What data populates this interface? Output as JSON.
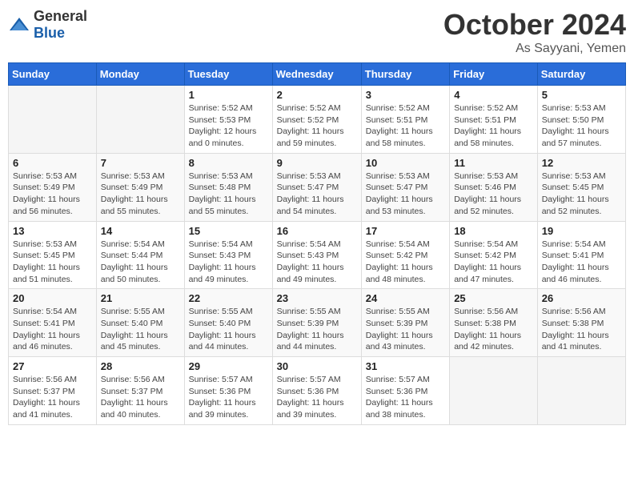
{
  "logo": {
    "general": "General",
    "blue": "Blue"
  },
  "header": {
    "month": "October 2024",
    "location": "As Sayyani, Yemen"
  },
  "weekdays": [
    "Sunday",
    "Monday",
    "Tuesday",
    "Wednesday",
    "Thursday",
    "Friday",
    "Saturday"
  ],
  "weeks": [
    [
      {
        "day": "",
        "info": ""
      },
      {
        "day": "",
        "info": ""
      },
      {
        "day": "1",
        "info": "Sunrise: 5:52 AM\nSunset: 5:53 PM\nDaylight: 12 hours\nand 0 minutes."
      },
      {
        "day": "2",
        "info": "Sunrise: 5:52 AM\nSunset: 5:52 PM\nDaylight: 11 hours\nand 59 minutes."
      },
      {
        "day": "3",
        "info": "Sunrise: 5:52 AM\nSunset: 5:51 PM\nDaylight: 11 hours\nand 58 minutes."
      },
      {
        "day": "4",
        "info": "Sunrise: 5:52 AM\nSunset: 5:51 PM\nDaylight: 11 hours\nand 58 minutes."
      },
      {
        "day": "5",
        "info": "Sunrise: 5:53 AM\nSunset: 5:50 PM\nDaylight: 11 hours\nand 57 minutes."
      }
    ],
    [
      {
        "day": "6",
        "info": "Sunrise: 5:53 AM\nSunset: 5:49 PM\nDaylight: 11 hours\nand 56 minutes."
      },
      {
        "day": "7",
        "info": "Sunrise: 5:53 AM\nSunset: 5:49 PM\nDaylight: 11 hours\nand 55 minutes."
      },
      {
        "day": "8",
        "info": "Sunrise: 5:53 AM\nSunset: 5:48 PM\nDaylight: 11 hours\nand 55 minutes."
      },
      {
        "day": "9",
        "info": "Sunrise: 5:53 AM\nSunset: 5:47 PM\nDaylight: 11 hours\nand 54 minutes."
      },
      {
        "day": "10",
        "info": "Sunrise: 5:53 AM\nSunset: 5:47 PM\nDaylight: 11 hours\nand 53 minutes."
      },
      {
        "day": "11",
        "info": "Sunrise: 5:53 AM\nSunset: 5:46 PM\nDaylight: 11 hours\nand 52 minutes."
      },
      {
        "day": "12",
        "info": "Sunrise: 5:53 AM\nSunset: 5:45 PM\nDaylight: 11 hours\nand 52 minutes."
      }
    ],
    [
      {
        "day": "13",
        "info": "Sunrise: 5:53 AM\nSunset: 5:45 PM\nDaylight: 11 hours\nand 51 minutes."
      },
      {
        "day": "14",
        "info": "Sunrise: 5:54 AM\nSunset: 5:44 PM\nDaylight: 11 hours\nand 50 minutes."
      },
      {
        "day": "15",
        "info": "Sunrise: 5:54 AM\nSunset: 5:43 PM\nDaylight: 11 hours\nand 49 minutes."
      },
      {
        "day": "16",
        "info": "Sunrise: 5:54 AM\nSunset: 5:43 PM\nDaylight: 11 hours\nand 49 minutes."
      },
      {
        "day": "17",
        "info": "Sunrise: 5:54 AM\nSunset: 5:42 PM\nDaylight: 11 hours\nand 48 minutes."
      },
      {
        "day": "18",
        "info": "Sunrise: 5:54 AM\nSunset: 5:42 PM\nDaylight: 11 hours\nand 47 minutes."
      },
      {
        "day": "19",
        "info": "Sunrise: 5:54 AM\nSunset: 5:41 PM\nDaylight: 11 hours\nand 46 minutes."
      }
    ],
    [
      {
        "day": "20",
        "info": "Sunrise: 5:54 AM\nSunset: 5:41 PM\nDaylight: 11 hours\nand 46 minutes."
      },
      {
        "day": "21",
        "info": "Sunrise: 5:55 AM\nSunset: 5:40 PM\nDaylight: 11 hours\nand 45 minutes."
      },
      {
        "day": "22",
        "info": "Sunrise: 5:55 AM\nSunset: 5:40 PM\nDaylight: 11 hours\nand 44 minutes."
      },
      {
        "day": "23",
        "info": "Sunrise: 5:55 AM\nSunset: 5:39 PM\nDaylight: 11 hours\nand 44 minutes."
      },
      {
        "day": "24",
        "info": "Sunrise: 5:55 AM\nSunset: 5:39 PM\nDaylight: 11 hours\nand 43 minutes."
      },
      {
        "day": "25",
        "info": "Sunrise: 5:56 AM\nSunset: 5:38 PM\nDaylight: 11 hours\nand 42 minutes."
      },
      {
        "day": "26",
        "info": "Sunrise: 5:56 AM\nSunset: 5:38 PM\nDaylight: 11 hours\nand 41 minutes."
      }
    ],
    [
      {
        "day": "27",
        "info": "Sunrise: 5:56 AM\nSunset: 5:37 PM\nDaylight: 11 hours\nand 41 minutes."
      },
      {
        "day": "28",
        "info": "Sunrise: 5:56 AM\nSunset: 5:37 PM\nDaylight: 11 hours\nand 40 minutes."
      },
      {
        "day": "29",
        "info": "Sunrise: 5:57 AM\nSunset: 5:36 PM\nDaylight: 11 hours\nand 39 minutes."
      },
      {
        "day": "30",
        "info": "Sunrise: 5:57 AM\nSunset: 5:36 PM\nDaylight: 11 hours\nand 39 minutes."
      },
      {
        "day": "31",
        "info": "Sunrise: 5:57 AM\nSunset: 5:36 PM\nDaylight: 11 hours\nand 38 minutes."
      },
      {
        "day": "",
        "info": ""
      },
      {
        "day": "",
        "info": ""
      }
    ]
  ]
}
